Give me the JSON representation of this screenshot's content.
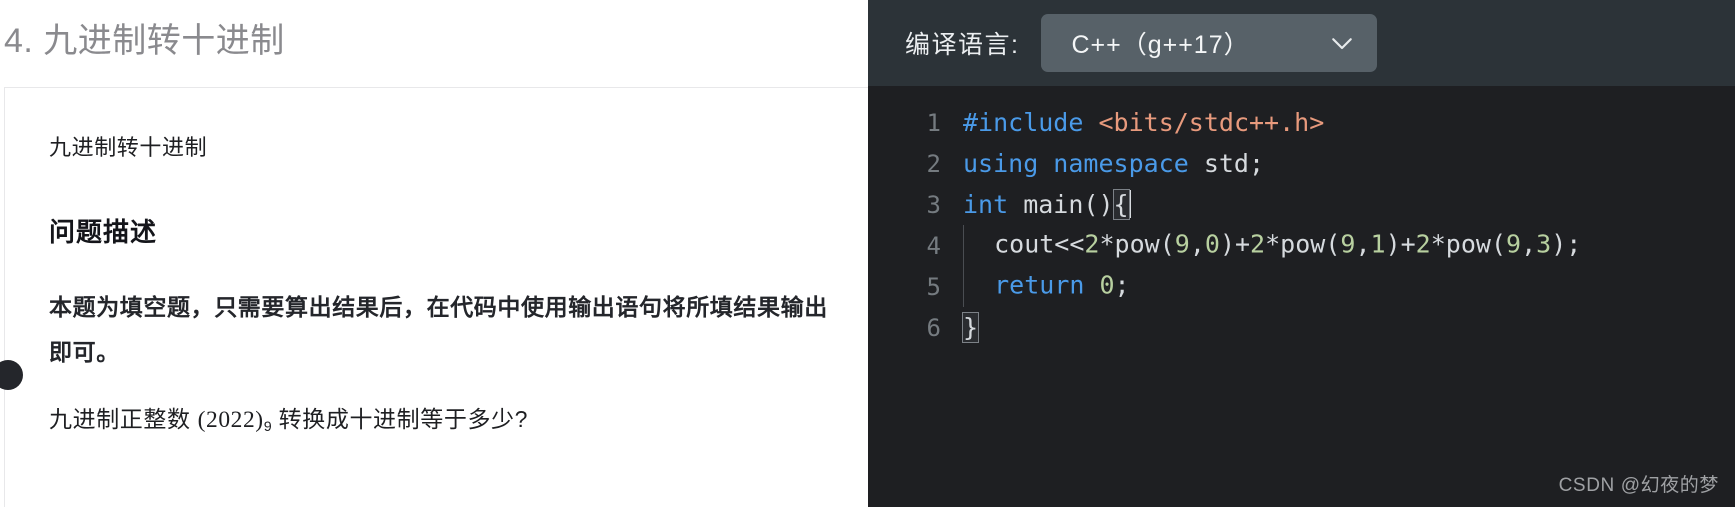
{
  "problem": {
    "title": "4. 九进制转十进制",
    "intro": "九进制转十进制",
    "section_heading": "问题描述",
    "note": "本题为填空题，只需要算出结果后，在代码中使用输出语句将所填结果输出即可。",
    "question_prefix": "九进制正整数 ",
    "question_number": "(2022)",
    "question_base": "9",
    "question_suffix": " 转换成十进制等于多少?"
  },
  "editor": {
    "language_label": "编译语言:",
    "language_value": "C++（g++17）",
    "chevron_icon": "chevron-down-icon",
    "line_numbers": [
      "1",
      "2",
      "3",
      "4",
      "5",
      "6"
    ],
    "lines": [
      {
        "number": "1",
        "tokens": [
          {
            "text": "#include",
            "type": "inc"
          },
          {
            "text": " ",
            "type": "plain"
          },
          {
            "text": "<bits/stdc++.h>",
            "type": "str"
          }
        ]
      },
      {
        "number": "2",
        "tokens": [
          {
            "text": "using namespace",
            "type": "kw"
          },
          {
            "text": " std;",
            "type": "plain"
          }
        ]
      },
      {
        "number": "3",
        "tokens": [
          {
            "text": "int",
            "type": "kw"
          },
          {
            "text": " main()",
            "type": "plain"
          },
          {
            "text": "{",
            "type": "brace-match"
          }
        ]
      },
      {
        "number": "4",
        "tokens": [
          {
            "text": "  cout<<",
            "type": "plain"
          },
          {
            "text": "2",
            "type": "num"
          },
          {
            "text": "*pow(",
            "type": "plain"
          },
          {
            "text": "9",
            "type": "num"
          },
          {
            "text": ",",
            "type": "plain"
          },
          {
            "text": "0",
            "type": "num"
          },
          {
            "text": ")+",
            "type": "plain"
          },
          {
            "text": "2",
            "type": "num"
          },
          {
            "text": "*pow(",
            "type": "plain"
          },
          {
            "text": "9",
            "type": "num"
          },
          {
            "text": ",",
            "type": "plain"
          },
          {
            "text": "1",
            "type": "num"
          },
          {
            "text": ")+",
            "type": "plain"
          },
          {
            "text": "2",
            "type": "num"
          },
          {
            "text": "*pow(",
            "type": "plain"
          },
          {
            "text": "9",
            "type": "num"
          },
          {
            "text": ",",
            "type": "plain"
          },
          {
            "text": "3",
            "type": "num"
          },
          {
            "text": ");",
            "type": "plain"
          }
        ]
      },
      {
        "number": "5",
        "tokens": [
          {
            "text": "  ",
            "type": "plain"
          },
          {
            "text": "return",
            "type": "kw"
          },
          {
            "text": " ",
            "type": "plain"
          },
          {
            "text": "0",
            "type": "num"
          },
          {
            "text": ";",
            "type": "plain"
          }
        ]
      },
      {
        "number": "6",
        "tokens": [
          {
            "text": "}",
            "type": "brace-match"
          }
        ]
      }
    ],
    "watermark": "CSDN @幻夜的梦"
  },
  "colors": {
    "editor_bg": "#1e1f22",
    "toolbar_bg": "#2c3338",
    "select_bg": "#576168",
    "keyword": "#4a9ae8",
    "string": "#e89a7d",
    "number": "#b8d0a0",
    "plain": "#d6dade",
    "gutter": "#757b80",
    "title": "#8a8a8e"
  }
}
